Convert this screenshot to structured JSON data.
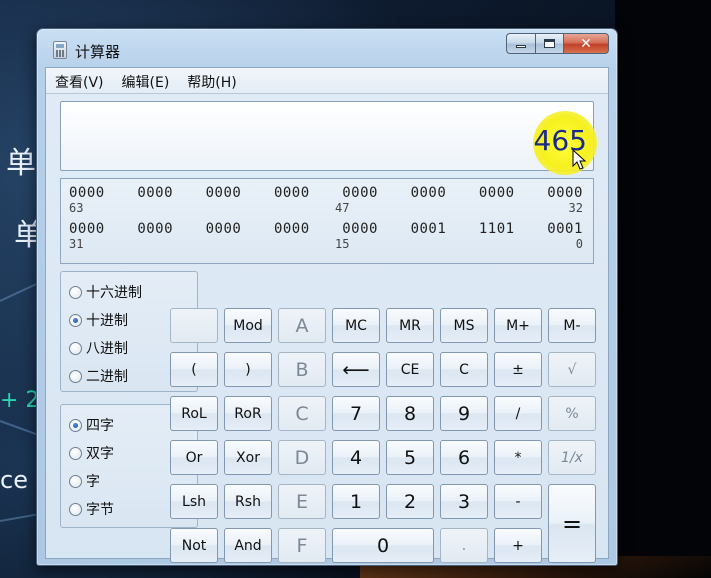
{
  "window": {
    "title": "计算器"
  },
  "menu": [
    {
      "label": "查看(V)"
    },
    {
      "label": "编辑(E)"
    },
    {
      "label": "帮助(H)"
    }
  ],
  "display": {
    "value": "465"
  },
  "bits": {
    "rows": [
      {
        "groups": [
          "0000",
          "0000",
          "0000",
          "0000",
          "0000",
          "0000",
          "0000",
          "0000"
        ],
        "positions": [
          "63",
          "47",
          "32"
        ]
      },
      {
        "groups": [
          "0000",
          "0000",
          "0000",
          "0000",
          "0000",
          "0001",
          "1101",
          "0001"
        ],
        "positions": [
          "31",
          "15",
          "0"
        ]
      }
    ]
  },
  "base_options": [
    {
      "label": "十六进制",
      "checked": false
    },
    {
      "label": "十进制",
      "checked": true
    },
    {
      "label": "八进制",
      "checked": false
    },
    {
      "label": "二进制",
      "checked": false
    }
  ],
  "word_options": [
    {
      "label": "四字",
      "checked": true
    },
    {
      "label": "双字",
      "checked": false
    },
    {
      "label": "字",
      "checked": false
    },
    {
      "label": "字节",
      "checked": false
    }
  ],
  "buttons": {
    "mod": "Mod",
    "a": "A",
    "mc": "MC",
    "mr": "MR",
    "ms": "MS",
    "mplus": "M+",
    "mminus": "M-",
    "lparen": "(",
    "rparen": ")",
    "b": "B",
    "backspace": "⟵",
    "ce": "CE",
    "c": "C",
    "plusminus": "±",
    "sqrt": "√",
    "rol": "RoL",
    "ror": "RoR",
    "cc": "C",
    "seven": "7",
    "eight": "8",
    "nine": "9",
    "divide": "/",
    "percent": "%",
    "or": "Or",
    "xor": "Xor",
    "d": "D",
    "four": "4",
    "five": "5",
    "six": "6",
    "multiply": "*",
    "reciprocal": "1/x",
    "lsh": "Lsh",
    "rsh": "Rsh",
    "e": "E",
    "one": "1",
    "two": "2",
    "three": "3",
    "minus": "-",
    "equals": "=",
    "not": "Not",
    "and": "And",
    "f": "F",
    "zero": "0",
    "dot": ".",
    "plus": "+"
  },
  "background": {
    "left_chars": [
      "单",
      "单",
      "+ 2",
      "ce"
    ]
  }
}
